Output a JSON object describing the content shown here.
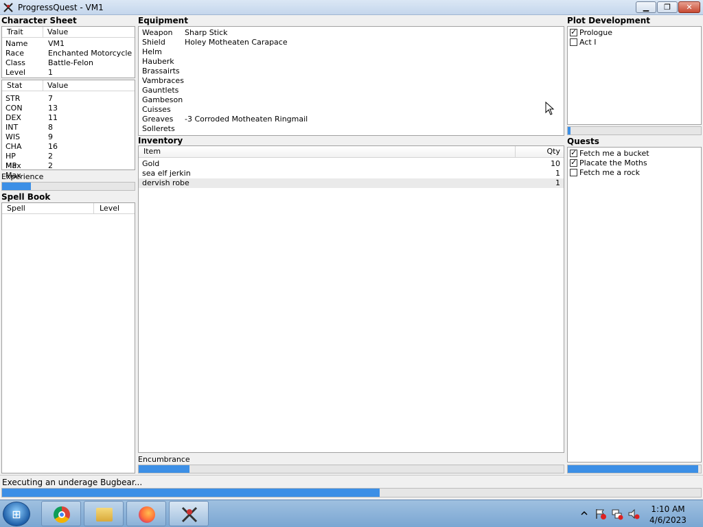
{
  "window": {
    "title": "ProgressQuest - VM1"
  },
  "character_sheet": {
    "section_label": "Character Sheet",
    "traits_header": {
      "col1": "Trait",
      "col2": "Value"
    },
    "traits": [
      {
        "key": "Name",
        "value": "VM1"
      },
      {
        "key": "Race",
        "value": "Enchanted Motorcycle"
      },
      {
        "key": "Class",
        "value": "Battle-Felon"
      },
      {
        "key": "Level",
        "value": "1"
      }
    ],
    "stats_header": {
      "col1": "Stat",
      "col2": "Value"
    },
    "stats": [
      {
        "key": "STR",
        "value": "7"
      },
      {
        "key": "CON",
        "value": "13"
      },
      {
        "key": "DEX",
        "value": "11"
      },
      {
        "key": "INT",
        "value": "8"
      },
      {
        "key": "WIS",
        "value": "9"
      },
      {
        "key": "CHA",
        "value": "16"
      },
      {
        "key": "HP Max",
        "value": "2"
      },
      {
        "key": "MP Max",
        "value": "2"
      }
    ],
    "experience_label": "Experience",
    "experience_progress": 0.22
  },
  "spell_book": {
    "section_label": "Spell Book",
    "header": {
      "col1": "Spell",
      "col2": "Level"
    }
  },
  "equipment": {
    "section_label": "Equipment",
    "items": [
      {
        "slot": "Weapon",
        "item": "Sharp Stick"
      },
      {
        "slot": "Shield",
        "item": "Holey Motheaten Carapace"
      },
      {
        "slot": "Helm",
        "item": ""
      },
      {
        "slot": "Hauberk",
        "item": ""
      },
      {
        "slot": "Brassairts",
        "item": ""
      },
      {
        "slot": "Vambraces",
        "item": ""
      },
      {
        "slot": "Gauntlets",
        "item": ""
      },
      {
        "slot": "Gambeson",
        "item": ""
      },
      {
        "slot": "Cuisses",
        "item": ""
      },
      {
        "slot": "Greaves",
        "item": "-3 Corroded Motheaten Ringmail"
      },
      {
        "slot": "Sollerets",
        "item": ""
      }
    ]
  },
  "inventory": {
    "section_label": "Inventory",
    "header": {
      "col1": "Item",
      "col2": "Qty"
    },
    "rows": [
      {
        "item": "Gold",
        "qty": "10"
      },
      {
        "item": "sea elf jerkin",
        "qty": "1"
      },
      {
        "item": "dervish robe",
        "qty": "1"
      }
    ],
    "encumbrance_label": "Encumbrance",
    "encumbrance_progress": 0.12
  },
  "plot": {
    "section_label": "Plot Development",
    "acts": [
      {
        "label": "Prologue",
        "checked": true
      },
      {
        "label": "Act I",
        "checked": false
      }
    ],
    "plot_progress": 0.02
  },
  "quests": {
    "section_label": "Quests",
    "items": [
      {
        "label": "Fetch me a bucket",
        "checked": true
      },
      {
        "label": "Placate the Moths",
        "checked": true
      },
      {
        "label": "Fetch me a rock",
        "checked": false
      }
    ],
    "quest_progress": 0.98
  },
  "status": {
    "task_text": "Executing an underage Bugbear...",
    "task_progress": 0.54
  },
  "taskbar": {
    "clock_time": "1:10 AM",
    "clock_date": "4/6/2023",
    "start_icon": "windows-logo-icon",
    "pinned": [
      "chrome-icon",
      "file-explorer-icon",
      "firefox-icon",
      "progressquest-icon"
    ]
  },
  "colors": {
    "progress_fill": "#3c8fe6",
    "window_bg": "#f0f0f0",
    "taskbar": "#8fb4da"
  }
}
